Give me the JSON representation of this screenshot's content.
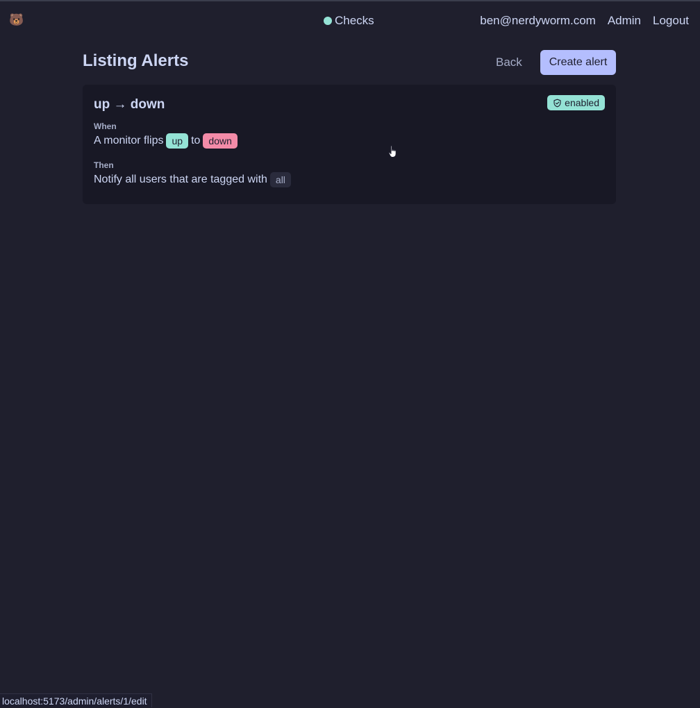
{
  "nav": {
    "logo": "🐻",
    "center_link": "Checks",
    "user_email": "ben@nerdyworm.com",
    "admin_link": "Admin",
    "logout_link": "Logout"
  },
  "page": {
    "title": "Listing Alerts",
    "back_label": "Back",
    "create_label": "Create alert"
  },
  "alerts": [
    {
      "title": "up → down",
      "status": "enabled",
      "when_label": "When",
      "when_prefix": "A monitor flips",
      "from_state": "up",
      "connector": "to",
      "to_state": "down",
      "then_label": "Then",
      "then_text": "Notify all users that are tagged with",
      "tag": "all"
    }
  ],
  "status_bar": {
    "url": "localhost:5173/admin/alerts/1/edit"
  },
  "colors": {
    "background": "#1f1f2d",
    "card": "#181825",
    "accent": "#b4befe",
    "success": "#94e2d5",
    "danger": "#f38ba8"
  }
}
